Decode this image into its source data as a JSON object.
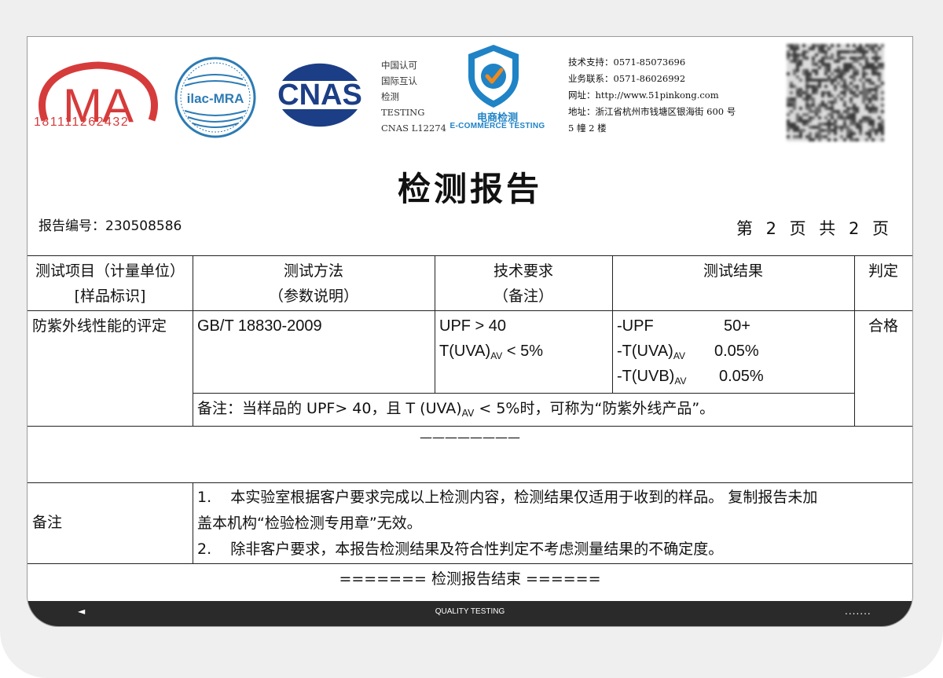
{
  "header": {
    "cma_text": "MA",
    "cma_number": "181111262432",
    "ilac_text": "ilac-MRA",
    "cnas_logo_text": "CNAS",
    "cnas_lines": [
      "中国认可",
      "国际互认",
      "检测",
      "TESTING",
      "CNAS L12274"
    ],
    "ec_cn": "电商检测",
    "ec_en": "E-COMMERCE TESTING",
    "contact_lines": [
      "技术支持：0571-85073696",
      "业务联系：0571-86026992",
      "网址：http://www.51pinkong.com",
      "地址：浙江省杭州市钱塘区银海街 600 号",
      "5 幢 2 楼"
    ],
    "colors": {
      "cma_red": "#d63b3b",
      "ilac_blue": "#2c7bb5",
      "cnas_navy": "#1b3e86",
      "ec_blue": "#1f83c6",
      "ec_orange": "#f08a1c"
    }
  },
  "title": "检测报告",
  "report_no": "报告编号：230508586",
  "page": "第 2 页 共 2 页",
  "table": {
    "headers": {
      "item_line1": "测试项目（计量单位）",
      "item_line2": "[样品标识]",
      "method_line1": "测试方法",
      "method_line2": "（参数说明）",
      "req_line1": "技术要求",
      "req_line2": "（备注）",
      "result": "测试结果",
      "judge": "判定"
    },
    "row": {
      "item": "防紫外线性能的评定",
      "method": "GB/T 18830-2009",
      "req1": "UPF > 40",
      "req2_pre": "T(UVA)",
      "req2_sub": "AV",
      "req2_post": " < 5%",
      "results": [
        {
          "name": "-UPF",
          "sub": "",
          "value": "50+"
        },
        {
          "name": "-T(UVA)",
          "sub": "AV",
          "value": "0.05%"
        },
        {
          "name": "-T(UVB)",
          "sub": "AV",
          "value": "0.05%"
        }
      ],
      "judge": "合格",
      "note_pre": "备注：当样品的 UPF> 40，且 T (UVA)",
      "note_sub": "AV",
      "note_post": " < 5%时，可称为“防紫外线产品”。"
    },
    "blank_line": "————————",
    "remarks_label": "备注",
    "remarks": [
      "1.    本实验室根据客户要求完成以上检测内容，检测结果仅适用于收到的样品。 复制报告未加",
      "盖本机构“检验检测专用章”无效。",
      "2.    除非客户要求，本报告检测结果及符合性判定不考虑测量结果的不确定度。"
    ],
    "end": "======= 检测报告结束 ======"
  },
  "footer": {
    "left": "◄",
    "center": "QUALITY TESTING",
    "right": "......."
  }
}
